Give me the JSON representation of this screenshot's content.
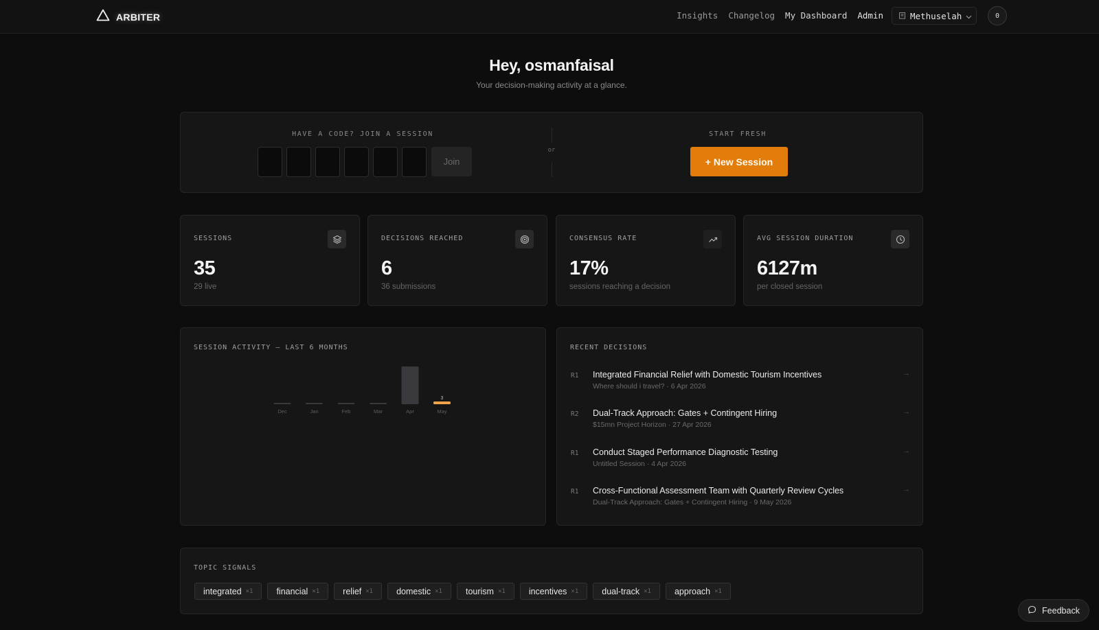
{
  "nav": {
    "brand": "ARBITER",
    "links": [
      "Insights",
      "Changelog",
      "My Dashboard",
      "Admin"
    ],
    "org": "Methuselah",
    "notification_count": "0"
  },
  "header": {
    "greeting": "Hey, osmanfaisal",
    "subtitle": "Your decision-making activity at a glance."
  },
  "join": {
    "label": "HAVE A CODE? JOIN A SESSION",
    "button": "Join",
    "or": "or",
    "fresh_label": "START FRESH",
    "new_session": "+ New Session"
  },
  "stats": [
    {
      "label": "SESSIONS",
      "value": "35",
      "sub": "29 live",
      "icon": "layers-icon"
    },
    {
      "label": "DECISIONS REACHED",
      "value": "6",
      "sub": "36 submissions",
      "icon": "target-icon"
    },
    {
      "label": "CONSENSUS RATE",
      "value": "17%",
      "sub": "sessions reaching a decision",
      "icon": "trend-up-icon"
    },
    {
      "label": "AVG SESSION DURATION",
      "value": "6127m",
      "sub": "per closed session",
      "icon": "clock-icon"
    }
  ],
  "activity": {
    "label": "SESSION ACTIVITY — LAST 6 MONTHS"
  },
  "chart_data": {
    "type": "bar",
    "categories": [
      "Dec",
      "Jan",
      "Feb",
      "Mar",
      "Apr",
      "May"
    ],
    "values": [
      0,
      0,
      0,
      0,
      32,
      3
    ],
    "highlight_index": 5,
    "data_labels": [
      "",
      "",
      "",
      "",
      "",
      "3"
    ],
    "colors": {
      "bar": "#3a3a3e",
      "highlight": "#f0a348",
      "empty": "#3a3a3a"
    }
  },
  "recent": {
    "label": "RECENT DECISIONS",
    "items": [
      {
        "round": "R1",
        "title": "Integrated Financial Relief with Domestic Tourism Incentives",
        "meta": "Where should i travel? · 6 Apr 2026"
      },
      {
        "round": "R2",
        "title": "Dual-Track Approach: Gates + Contingent Hiring",
        "meta": "$15mn Project Horizon · 27 Apr 2026"
      },
      {
        "round": "R1",
        "title": "Conduct Staged Performance Diagnostic Testing",
        "meta": "Untitled Session · 4 Apr 2026"
      },
      {
        "round": "R1",
        "title": "Cross-Functional Assessment Team with Quarterly Review Cycles",
        "meta": "Dual-Track Approach: Gates + Contingent Hiring · 9 May 2026"
      }
    ]
  },
  "topics": {
    "label": "TOPIC SIGNALS",
    "chips": [
      {
        "name": "integrated",
        "count": "×1"
      },
      {
        "name": "financial",
        "count": "×1"
      },
      {
        "name": "relief",
        "count": "×1"
      },
      {
        "name": "domestic",
        "count": "×1"
      },
      {
        "name": "tourism",
        "count": "×1"
      },
      {
        "name": "incentives",
        "count": "×1"
      },
      {
        "name": "dual-track",
        "count": "×1"
      },
      {
        "name": "approach",
        "count": "×1"
      }
    ]
  },
  "feedback": {
    "label": "Feedback"
  },
  "theme": {
    "accent": "#e27d0c",
    "background": "#0d0d0d",
    "card": "#161616"
  }
}
